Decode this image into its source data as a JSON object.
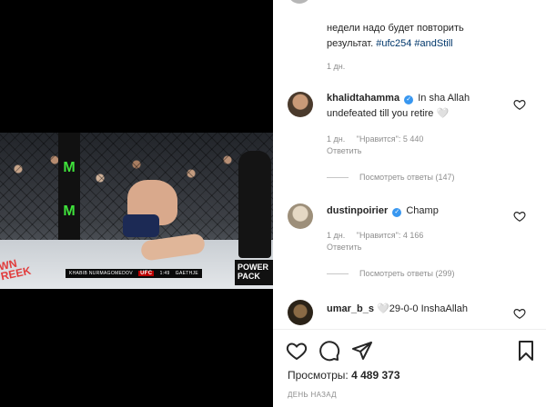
{
  "video": {
    "scorebar_left": "KHABIB NURMAGOMEDOV",
    "scorebar_logo": "UFC",
    "scorebar_time": "1:49",
    "scorebar_right": "GAETHJE",
    "corner_tag": "WN REEK",
    "brand": "POWER PACK"
  },
  "caption": {
    "line1": "недели надо будет повторить",
    "line2_prefix": "результат.",
    "hashtag1": "#ufc254",
    "hashtag2": "#andStill",
    "time": "1 дн."
  },
  "comments": [
    {
      "user": "khalidtahamma",
      "text_line1": "In sha Allah",
      "text_line2": "undefeated till you retire 🤍",
      "time": "1 дн.",
      "likes": "\"Нравится\": 5 440",
      "reply": "Ответить",
      "view_replies": "Посмотреть ответы (147)"
    },
    {
      "user": "dustinpoirier",
      "text_line1": "Champ",
      "time": "1 дн.",
      "likes": "\"Нравится\": 4 166",
      "reply": "Ответить",
      "view_replies": "Посмотреть ответы (299)"
    },
    {
      "user": "umar_b_s",
      "text_line1": "🤍29-0-0 InshaAllah"
    }
  ],
  "stats": {
    "views_label": "Просмотры:",
    "views_value": "4 489 373",
    "date": "ДЕНЬ НАЗАД"
  },
  "colors": {
    "verified": "#3897f0",
    "hashtag": "#00376b",
    "muted": "#8e8e8e"
  }
}
